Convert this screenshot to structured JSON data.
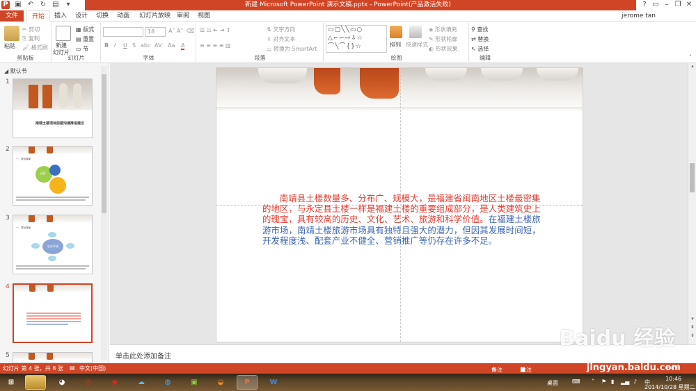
{
  "window": {
    "title": "新建 Microsoft PowerPoint 演示文稿.pptx - PowerPoint(产品激活失败)",
    "controls": [
      "?",
      "▭",
      "–",
      "❐",
      "✕"
    ]
  },
  "tabs": [
    {
      "label": "文件"
    },
    {
      "label": "开始"
    },
    {
      "label": "插入"
    },
    {
      "label": "设计"
    },
    {
      "label": "切换"
    },
    {
      "label": "动画"
    },
    {
      "label": "幻灯片放映"
    },
    {
      "label": "审阅"
    },
    {
      "label": "视图"
    }
  ],
  "user": "jerome tan",
  "ribbon": {
    "clipboard": {
      "paste": "粘贴",
      "cut": "剪切",
      "copy": "复制",
      "format_painter": "格式刷",
      "label": "剪贴板"
    },
    "slides": {
      "new_slide": "新建",
      "new_slide_2": "幻灯片",
      "layout": "版式",
      "reset": "重置",
      "section": "节",
      "label": "幻灯片"
    },
    "font": {
      "size": "18",
      "label": "字体",
      "bold": "B",
      "italic": "I",
      "underline": "U",
      "strike": "S",
      "shadow": "abc",
      "spacing": "AV",
      "case": "Aa",
      "color": "A"
    },
    "paragraph": {
      "text_direction": "文字方向",
      "align_text": "对齐文本",
      "smartart": "转换为 SmartArt",
      "label": "段落"
    },
    "drawing": {
      "arrange": "排列",
      "quick_styles": "快速样式",
      "shape_fill": "形状填充",
      "shape_outline": "形状轮廓",
      "shape_effects": "形状效果",
      "label": "绘图"
    },
    "editing": {
      "find": "查找",
      "replace": "替换",
      "select": "选择",
      "label": "编辑"
    }
  },
  "slide_panel": {
    "section": "默认节",
    "slides": [
      {
        "number": "1",
        "title": "南靖土楼项目前期沟通推进建议"
      },
      {
        "number": "2",
        "center_text": "土楼",
        "heading": "一、项目背景"
      },
      {
        "number": "3",
        "center_text": "生存环境",
        "heading": "一、项目背景"
      },
      {
        "number": "4"
      },
      {
        "number": "5"
      }
    ]
  },
  "slide_text": {
    "red": "南靖县土楼数量多、分布广、规模大，是福建省闽南地区土楼最密集的地区，与永定县土楼一样是福建土楼的重要组成部分，是人类建筑史上的瑰宝，具有较高的历史、文化、艺术、旅游和科学价值。",
    "blue": "在福建土楼旅游市场，南靖土楼旅游市场具有独特且强大的潜力，但因其发展时间短，开发程度浅、配套产业不健全、营销推广等仍存在许多不足。"
  },
  "notes_placeholder": "单击此处添加备注",
  "status": {
    "slide_info": "幻灯片 第 4 张，共 8 张",
    "language": "中文(中国)",
    "notes": "备注",
    "comments": "批注",
    "zoom": "84%"
  },
  "taskbar": {
    "desktop": "桌面",
    "ime": "中",
    "time": "10:46",
    "date": "2014/10/28 星期二"
  },
  "watermark": {
    "logo": "Baidu 经验",
    "url": "jingyan.baidu.com"
  },
  "colors": {
    "accent": "#d04525",
    "slide_red": "#e23b2f",
    "slide_blue": "#3b63b5"
  }
}
